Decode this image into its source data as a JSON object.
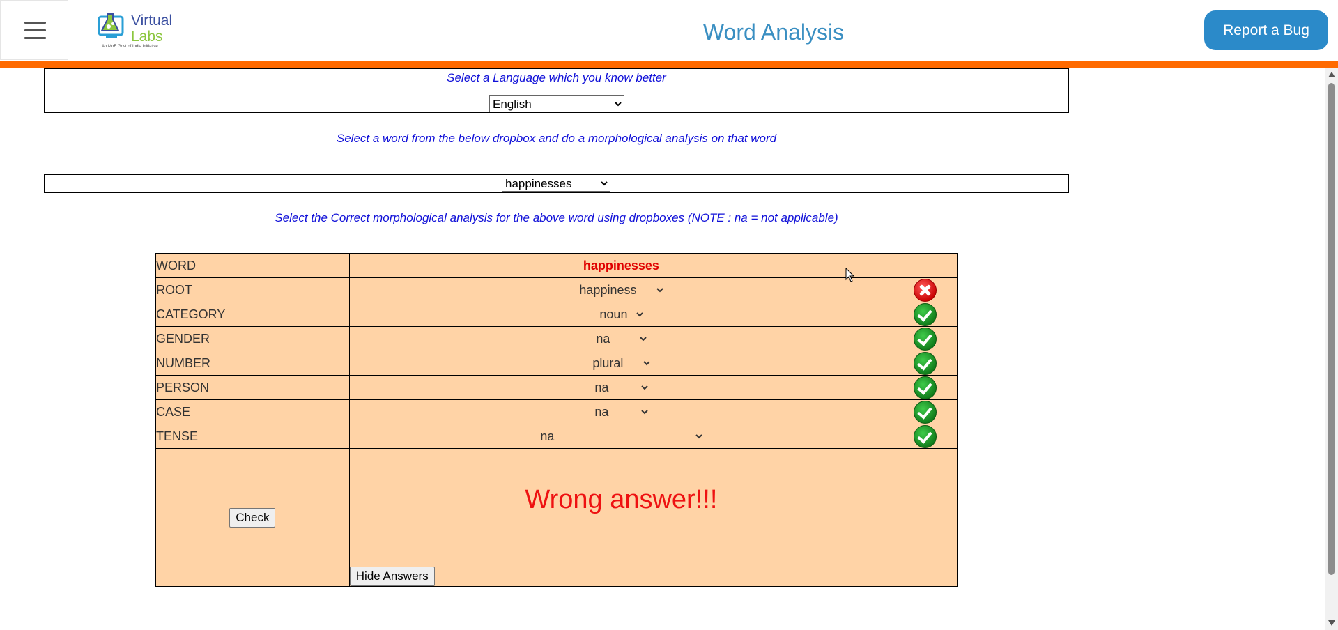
{
  "header": {
    "logo_line1": "Virtual",
    "logo_line2": "Labs",
    "logo_tagline": "An MoE Govt of India Initiative",
    "title": "Word Analysis",
    "report_bug": "Report a Bug"
  },
  "language_section": {
    "instruction": "Select a Language which you know better",
    "selected": "English"
  },
  "word_section": {
    "instruction": "Select a word from the below dropbox and do a morphological analysis on that word",
    "selected": "happinesses"
  },
  "analysis_instruction": "Select the Correct morphological analysis for the above word using dropboxes (NOTE : na = not applicable)",
  "table": {
    "word_label": "WORD",
    "word_value": "happinesses",
    "rows": [
      {
        "label": "ROOT",
        "value": "happiness",
        "status": "wrong"
      },
      {
        "label": "CATEGORY",
        "value": "noun",
        "status": "correct"
      },
      {
        "label": "GENDER",
        "value": "na",
        "status": "correct"
      },
      {
        "label": "NUMBER",
        "value": "plural",
        "status": "correct"
      },
      {
        "label": "PERSON",
        "value": "na",
        "status": "correct"
      },
      {
        "label": "CASE",
        "value": "na",
        "status": "correct"
      },
      {
        "label": "TENSE",
        "value": "na",
        "status": "correct"
      }
    ],
    "check_button": "Check",
    "result_message": "Wrong answer!!!",
    "hide_button": "Hide Answers"
  },
  "icons": {
    "menu": "hamburger-icon",
    "correct": "check-circle-icon",
    "wrong": "x-circle-icon"
  },
  "colors": {
    "accent_orange": "#ff6a00",
    "button_blue": "#2b8ac9",
    "title_blue": "#3a8fc2",
    "instruction_blue": "#1010d8",
    "table_bg": "#ffd3a6",
    "error_red": "#ee1111"
  }
}
